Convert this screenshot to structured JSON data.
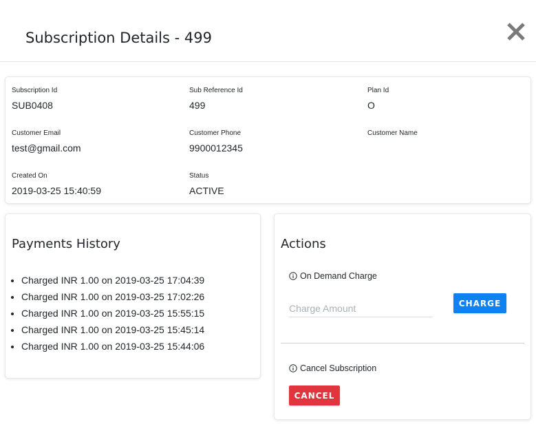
{
  "modal": {
    "title": "Subscription Details - 499"
  },
  "details": {
    "subscription_id": {
      "label": "Subscription Id",
      "value": "SUB0408"
    },
    "sub_reference_id": {
      "label": "Sub Reference Id",
      "value": "499"
    },
    "plan_id": {
      "label": "Plan Id",
      "value": "O"
    },
    "customer_email": {
      "label": "Customer Email",
      "value": "test@gmail.com"
    },
    "customer_phone": {
      "label": "Customer Phone",
      "value": "9900012345"
    },
    "customer_name": {
      "label": "Customer Name",
      "value": ""
    },
    "created_on": {
      "label": "Created On",
      "value": "2019-03-25 15:40:59"
    },
    "status": {
      "label": "Status",
      "value": "ACTIVE"
    }
  },
  "payments": {
    "heading": "Payments History",
    "items": [
      "Charged INR 1.00 on 2019-03-25 17:04:39",
      "Charged INR 1.00 on 2019-03-25 17:02:26",
      "Charged INR 1.00 on 2019-03-25 15:55:15",
      "Charged INR 1.00 on 2019-03-25 15:45:14",
      "Charged INR 1.00 on 2019-03-25 15:44:06"
    ]
  },
  "actions": {
    "heading": "Actions",
    "on_demand_label": "On Demand Charge",
    "charge_placeholder": "Charge Amount",
    "charge_value": "",
    "charge_button": "CHARGE",
    "cancel_label": "Cancel Subscription",
    "cancel_button": "CANCEL"
  },
  "icons": {
    "close": "close-icon",
    "info": "info-icon"
  },
  "colors": {
    "charge_button": "#0f81f0",
    "cancel_button": "#e0353f",
    "close_icon": "#7a7a7a"
  }
}
